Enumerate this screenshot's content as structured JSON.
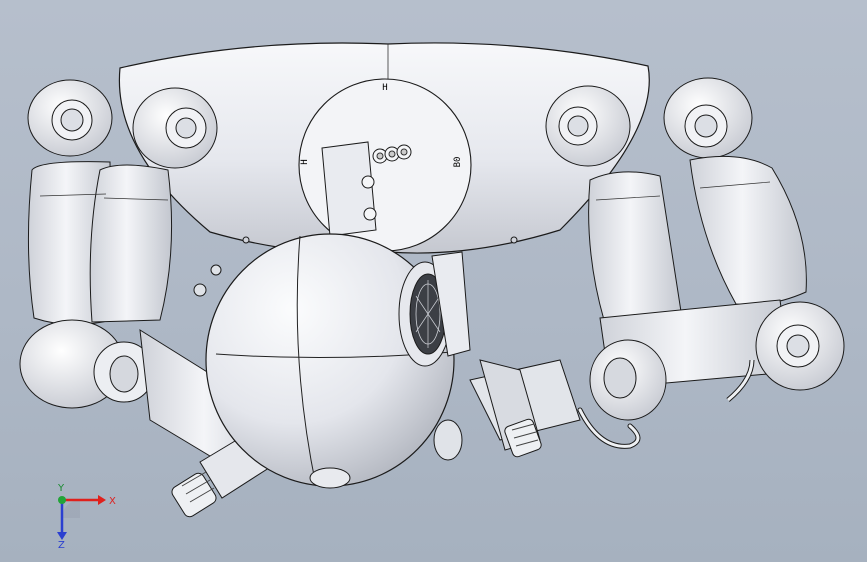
{
  "viewport": {
    "background_top": "#b6bfcc",
    "background_bottom": "#a6b1bf"
  },
  "model": {
    "body_color": "#eef0f4",
    "shadow_color": "#b9bcc4",
    "line_color": "#1b1b1b",
    "panel_labels": {
      "top": "H",
      "left": "H",
      "right": "B0"
    }
  },
  "triad": {
    "x_label": "X",
    "y_label": "Y",
    "z_label": "Z",
    "x_color": "#e0201c",
    "y_color": "#22a438",
    "z_color": "#2a3fd0"
  }
}
